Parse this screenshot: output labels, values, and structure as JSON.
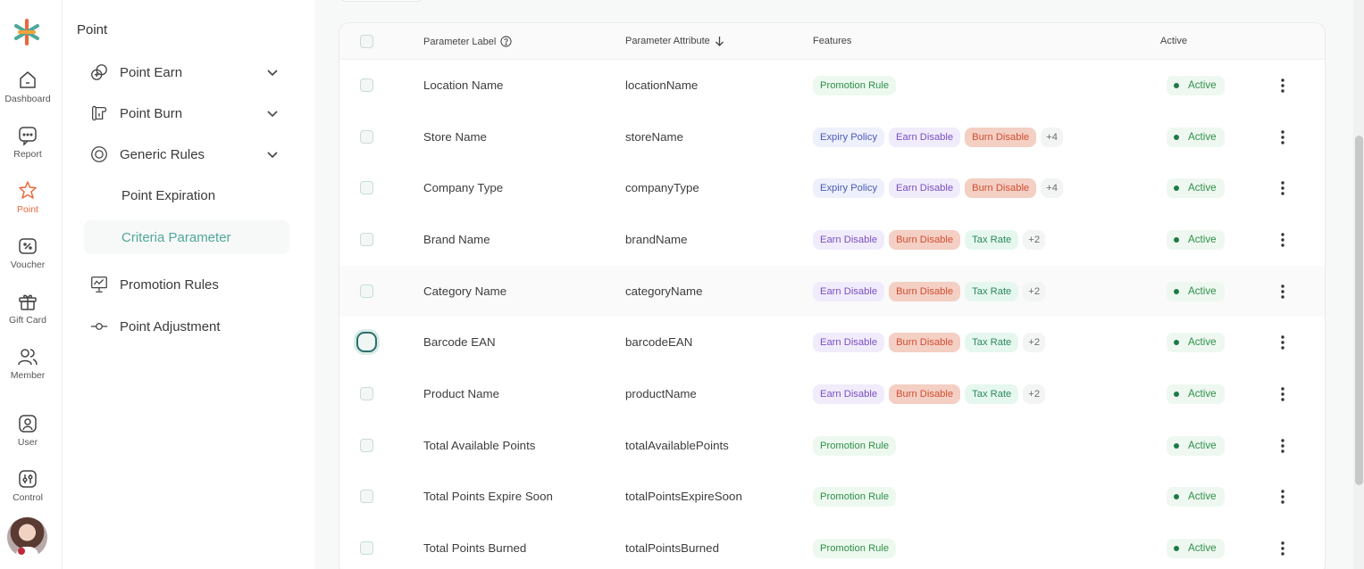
{
  "rail": {
    "items": [
      {
        "label": "Dashboard",
        "icon": "home-icon"
      },
      {
        "label": "Report",
        "icon": "report-icon"
      },
      {
        "label": "Point",
        "icon": "star-point-icon"
      },
      {
        "label": "Voucher",
        "icon": "voucher-icon"
      },
      {
        "label": "Gift Card",
        "icon": "gift-icon"
      },
      {
        "label": "Member",
        "icon": "member-icon"
      },
      {
        "label": "User",
        "icon": "user-icon"
      },
      {
        "label": "Control",
        "icon": "control-icon"
      }
    ],
    "active_index": 2
  },
  "subnav": {
    "title": "Point",
    "items": [
      {
        "label": "Point Earn",
        "icon": "point-earn-icon"
      },
      {
        "label": "Point Burn",
        "icon": "point-burn-icon"
      },
      {
        "label": "Generic Rules",
        "icon": "generic-rules-icon"
      },
      {
        "label": "Point Expiration"
      },
      {
        "label": "Criteria Parameter"
      },
      {
        "label": "Promotion Rules",
        "icon": "presentation-icon"
      },
      {
        "label": "Point Adjustment",
        "icon": "commit-icon"
      }
    ],
    "active_label": "Criteria Parameter"
  },
  "table": {
    "headers": {
      "label": "Parameter Label",
      "attribute": "Parameter Attribute",
      "features": "Features",
      "active": "Active"
    },
    "rows": [
      {
        "label": "Location Name",
        "attribute": "locationName",
        "features": [
          "Promotion Rule"
        ],
        "more": "",
        "status": "Active"
      },
      {
        "label": "Store Name",
        "attribute": "storeName",
        "features": [
          "Expiry Policy",
          "Earn Disable",
          "Burn Disable"
        ],
        "more": "+4",
        "status": "Active"
      },
      {
        "label": "Company Type",
        "attribute": "companyType",
        "features": [
          "Expiry Policy",
          "Earn Disable",
          "Burn Disable"
        ],
        "more": "+4",
        "status": "Active"
      },
      {
        "label": "Brand Name",
        "attribute": "brandName",
        "features": [
          "Earn Disable",
          "Burn Disable",
          "Tax Rate"
        ],
        "more": "+2",
        "status": "Active"
      },
      {
        "label": "Category Name",
        "attribute": "categoryName",
        "features": [
          "Earn Disable",
          "Burn Disable",
          "Tax Rate"
        ],
        "more": "+2",
        "status": "Active"
      },
      {
        "label": "Barcode EAN",
        "attribute": "barcodeEAN",
        "features": [
          "Earn Disable",
          "Burn Disable",
          "Tax Rate"
        ],
        "more": "+2",
        "status": "Active"
      },
      {
        "label": "Product Name",
        "attribute": "productName",
        "features": [
          "Earn Disable",
          "Burn Disable",
          "Tax Rate"
        ],
        "more": "+2",
        "status": "Active"
      },
      {
        "label": "Total Available Points",
        "attribute": "totalAvailablePoints",
        "features": [
          "Promotion Rule"
        ],
        "more": "",
        "status": "Active"
      },
      {
        "label": "Total Points Expire Soon",
        "attribute": "totalPointsExpireSoon",
        "features": [
          "Promotion Rule"
        ],
        "more": "",
        "status": "Active"
      },
      {
        "label": "Total Points Burned",
        "attribute": "totalPointsBurned",
        "features": [
          "Promotion Rule"
        ],
        "more": "",
        "status": "Active"
      }
    ],
    "hover_row": 4,
    "focused_checkbox_row": 5
  },
  "colors": {
    "accent": "#4fa89b",
    "point_active": "#e8673d",
    "status_green": "#2f8f49"
  }
}
